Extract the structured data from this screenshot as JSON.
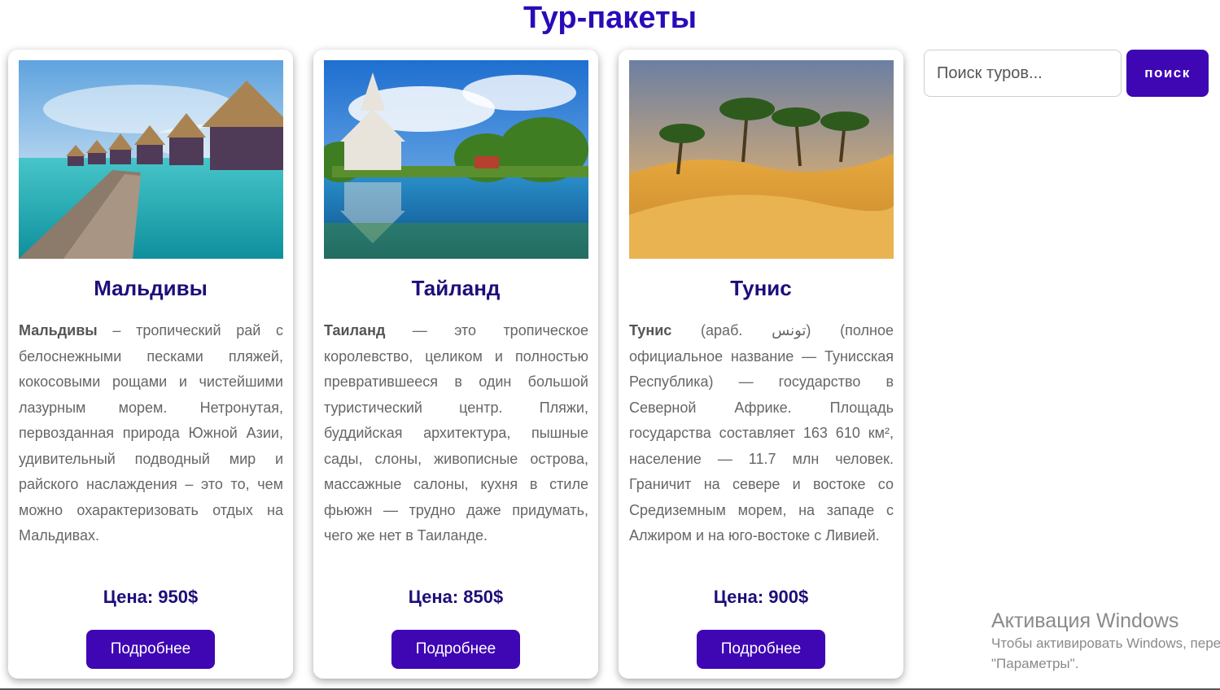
{
  "page": {
    "title": "Тур-пакеты"
  },
  "search": {
    "placeholder": "Поиск туров...",
    "button_label": "поиск"
  },
  "tours": [
    {
      "title": "Мальдивы",
      "desc_bold": "Мальдивы",
      "desc_rest": " – тропический рай с белоснежными песками пляжей, кокосовыми рощами и чистейшими лазурным морем. Нетронутая, первозданная природа Южной Азии, удивительный подводный мир и райского наслаждения – это то, чем можно охарактеризовать отдых на Мальдивах.",
      "price": "Цена: 950$",
      "button_label": "Подробнее",
      "image_icon": "maldives-bungalows-photo"
    },
    {
      "title": "Тайланд",
      "desc_bold": "Таиланд",
      "desc_rest": " — это тропическое королевство, целиком и полностью превратившееся в один большой туристический центр. Пляжи, буддийская архитектура, пышные сады, слоны, живописные острова, массажные салоны, кухня в стиле фьюжн — трудно даже придумать, чего же нет в Таиланде.",
      "price": "Цена: 850$",
      "button_label": "Подробнее",
      "image_icon": "thailand-temple-photo"
    },
    {
      "title": "Тунис",
      "desc_bold": "Тунис",
      "desc_rest": " (араб. تونس‎) (полное официальное название — Тунисская Республика) — государство в Северной Африке. Площадь государства составляет 163 610 км², население — 11.7 млн человек. Граничит на севере и востоке со Средиземным морем, на западе с Алжиром и на юго-востоке с Ливией.",
      "price": "Цена: 900$",
      "button_label": "Подробнее",
      "image_icon": "tunisia-desert-photo"
    }
  ],
  "windows_activation": {
    "title": "Активация Windows",
    "line1": "Чтобы активировать Windows, перейдите в раздел",
    "line2": "\"Параметры\"."
  }
}
